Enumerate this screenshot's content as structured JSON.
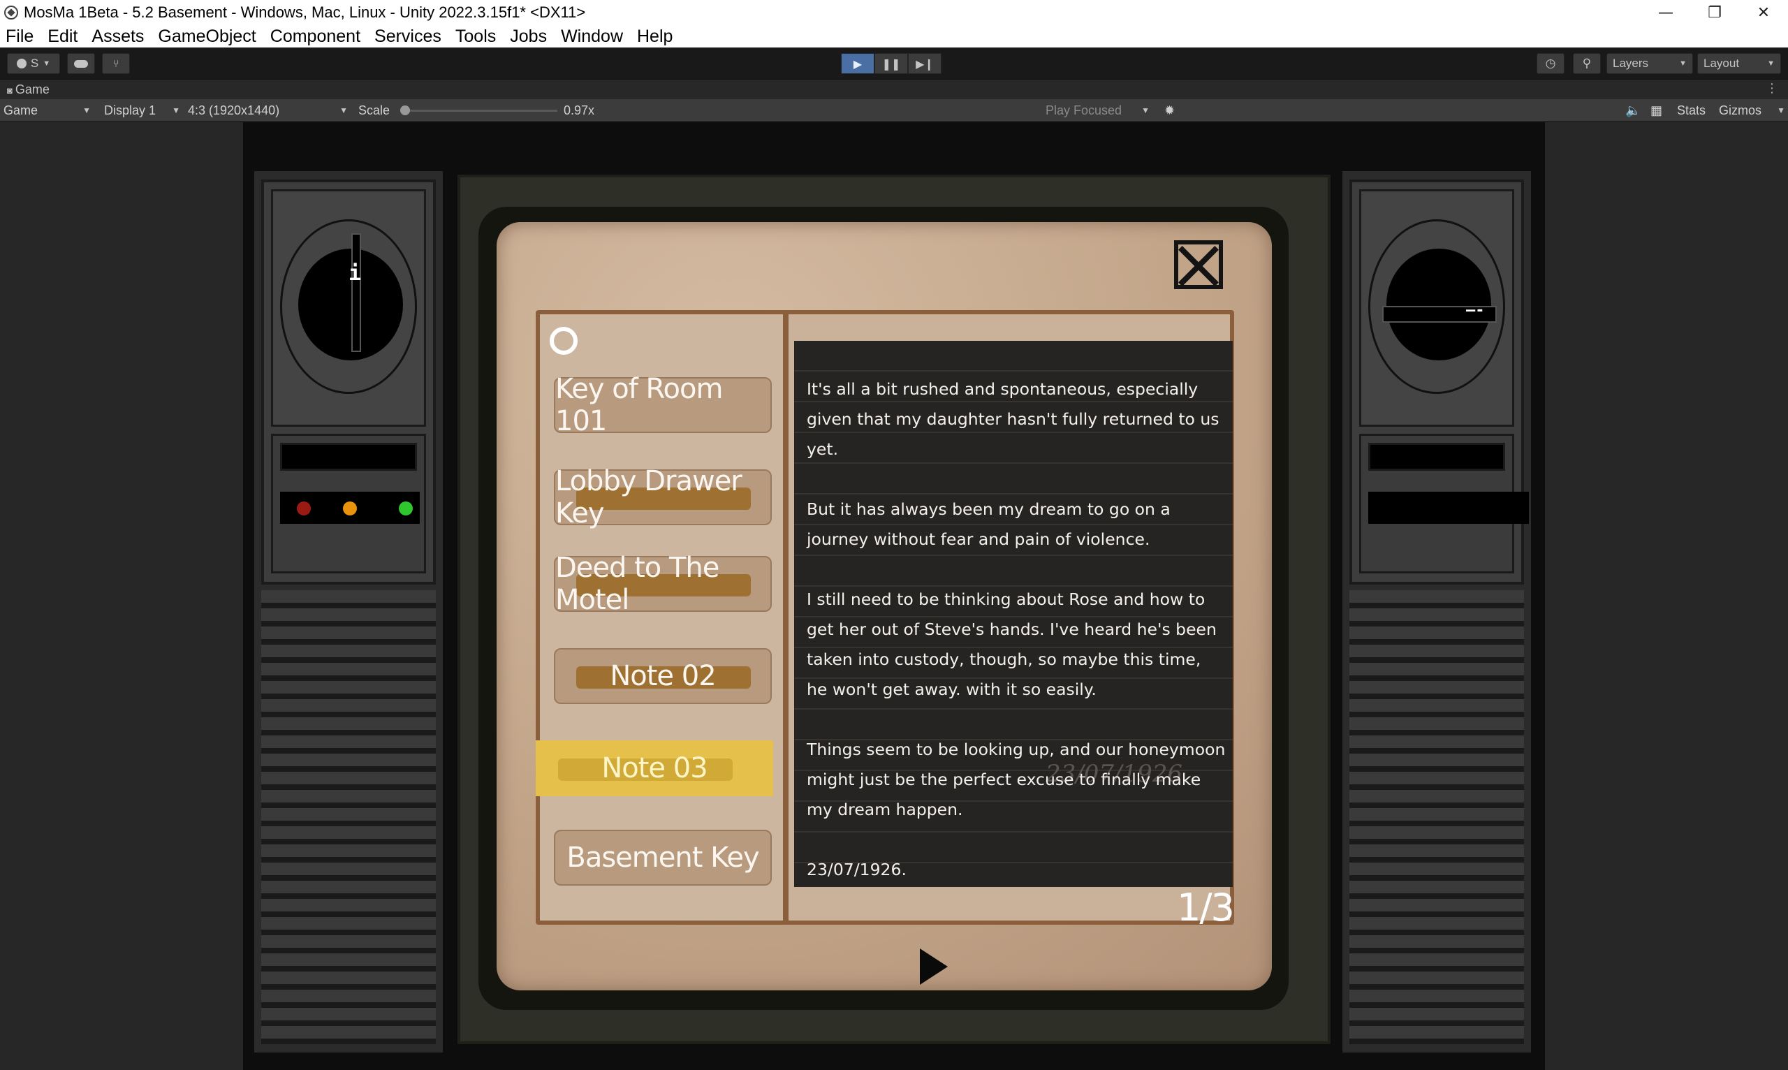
{
  "window": {
    "title": "MosMa 1Beta - 5.2 Basement - Windows, Mac, Linux - Unity 2022.3.15f1* <DX11>",
    "minimize": "—",
    "restore": "❐",
    "close": "✕"
  },
  "menu": [
    "File",
    "Edit",
    "Assets",
    "GameObject",
    "Component",
    "Services",
    "Tools",
    "Jobs",
    "Window",
    "Help"
  ],
  "toolbar": {
    "account_label": "S",
    "layers_label": "Layers",
    "layout_label": "Layout",
    "play_icon": "play-icon",
    "pause_icon": "pause-icon",
    "step_icon": "step-icon"
  },
  "game_view": {
    "tab_label": "Game",
    "mode_select": "Game",
    "display_select": "Display 1",
    "aspect_select": "4:3 (1920x1440)",
    "scale_label": "Scale",
    "scale_value": "0.97x",
    "scale_fraction": 0.03,
    "play_focused": "Play Focused",
    "stats_label": "Stats",
    "gizmos_label": "Gizmos"
  },
  "left_dial_mark": "i",
  "right_dial_mark": "—-",
  "lights": {
    "red": "#9b1b12",
    "orange": "#e8920e",
    "green": "#2ec82e"
  },
  "notebook": {
    "items": [
      {
        "label": "Key of Room 101"
      },
      {
        "label": "Lobby Drawer Key"
      },
      {
        "label": "Deed to The Motel"
      },
      {
        "label": "Note 02"
      },
      {
        "label": "Note 03"
      },
      {
        "label": "Basement Key"
      }
    ],
    "selected_index": 4,
    "note_paragraphs": [
      "It's all a bit rushed and spontaneous, especially given that my daughter hasn't fully returned to us yet.",
      "But it has always been my dream to go on a journey without fear and pain of violence.",
      "I still need to be thinking about Rose and how to get her out of Steve's hands. I've heard he's been taken into custody, though, so maybe this time, he won't get away. with it so easily.",
      "Things seem to be looking up, and our honeymoon might just be the perfect excuse to finally make my dream happen.",
      "23/07/1926."
    ],
    "background_date": "23/07/1926",
    "page_indicator": "1/3"
  }
}
